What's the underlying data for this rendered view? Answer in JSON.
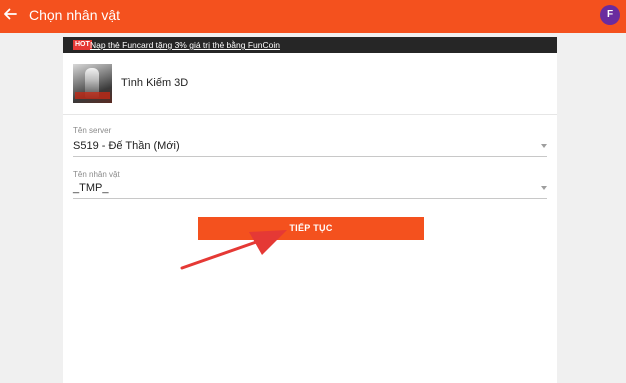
{
  "appbar": {
    "title": "Chọn nhân vật",
    "avatar_letter": "F",
    "avatar_color": "#6a2b9f",
    "accent_color": "#f4511e",
    "back_icon": "arrow-left-icon"
  },
  "promo": {
    "badge": "HOT",
    "text": "Nạp thẻ Funcard tặng 3% giá trị thẻ bằng FunCoin"
  },
  "game": {
    "name": "Tình Kiếm 3D"
  },
  "server_field": {
    "label": "Tên server",
    "value": "S519 - Đế Thần (Mới)"
  },
  "character_field": {
    "label": "Tên nhân vật",
    "value": "_TMP_"
  },
  "continue_button": {
    "label": "TIẾP TỤC"
  },
  "annotation": {
    "icon": "red-pointer-arrow",
    "color": "#e53935"
  }
}
